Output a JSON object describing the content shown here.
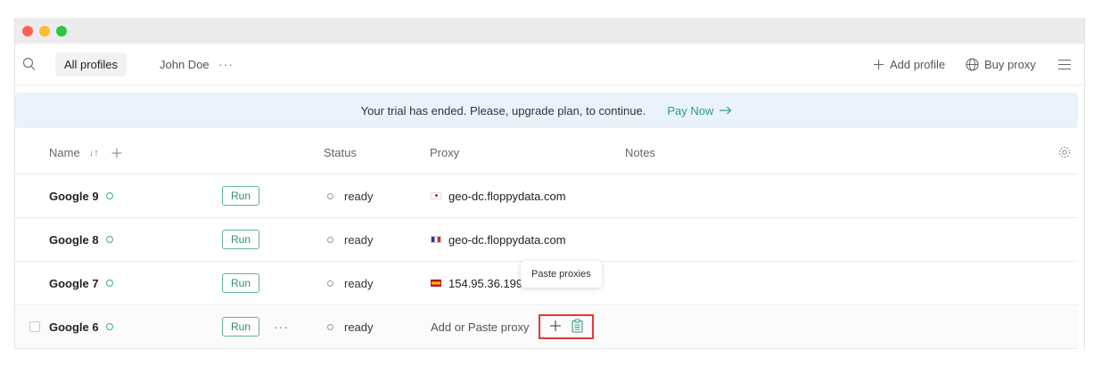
{
  "toolbar": {
    "tabs": [
      {
        "label": "All profiles",
        "active": true
      },
      {
        "label": "John Doe",
        "active": false
      }
    ],
    "more_label": "···",
    "add_profile_label": "Add profile",
    "buy_proxy_label": "Buy proxy"
  },
  "banner": {
    "message": "Your trial has ended. Please, upgrade plan, to continue.",
    "pay_now_label": "Pay Now"
  },
  "table": {
    "columns": {
      "name": "Name",
      "sort": "↓↑",
      "status": "Status",
      "proxy": "Proxy",
      "notes": "Notes"
    },
    "rows": [
      {
        "name": "Google 9",
        "run": "Run",
        "status": "ready",
        "proxy": "geo-dc.floppydata.com",
        "flag": "jp"
      },
      {
        "name": "Google 8",
        "run": "Run",
        "status": "ready",
        "proxy": "geo-dc.floppydata.com",
        "flag": "fr"
      },
      {
        "name": "Google 7",
        "run": "Run",
        "status": "ready",
        "proxy": "154.95.36.199",
        "flag": "es"
      },
      {
        "name": "Google 6",
        "run": "Run",
        "status": "ready",
        "proxy_placeholder": "Add or Paste proxy",
        "more": "···"
      }
    ]
  },
  "tooltip": {
    "text": "Paste proxies"
  },
  "colors": {
    "accent_green": "#2f9a84",
    "banner_bg": "#eaf3fb",
    "highlight_red": "#e53935"
  }
}
